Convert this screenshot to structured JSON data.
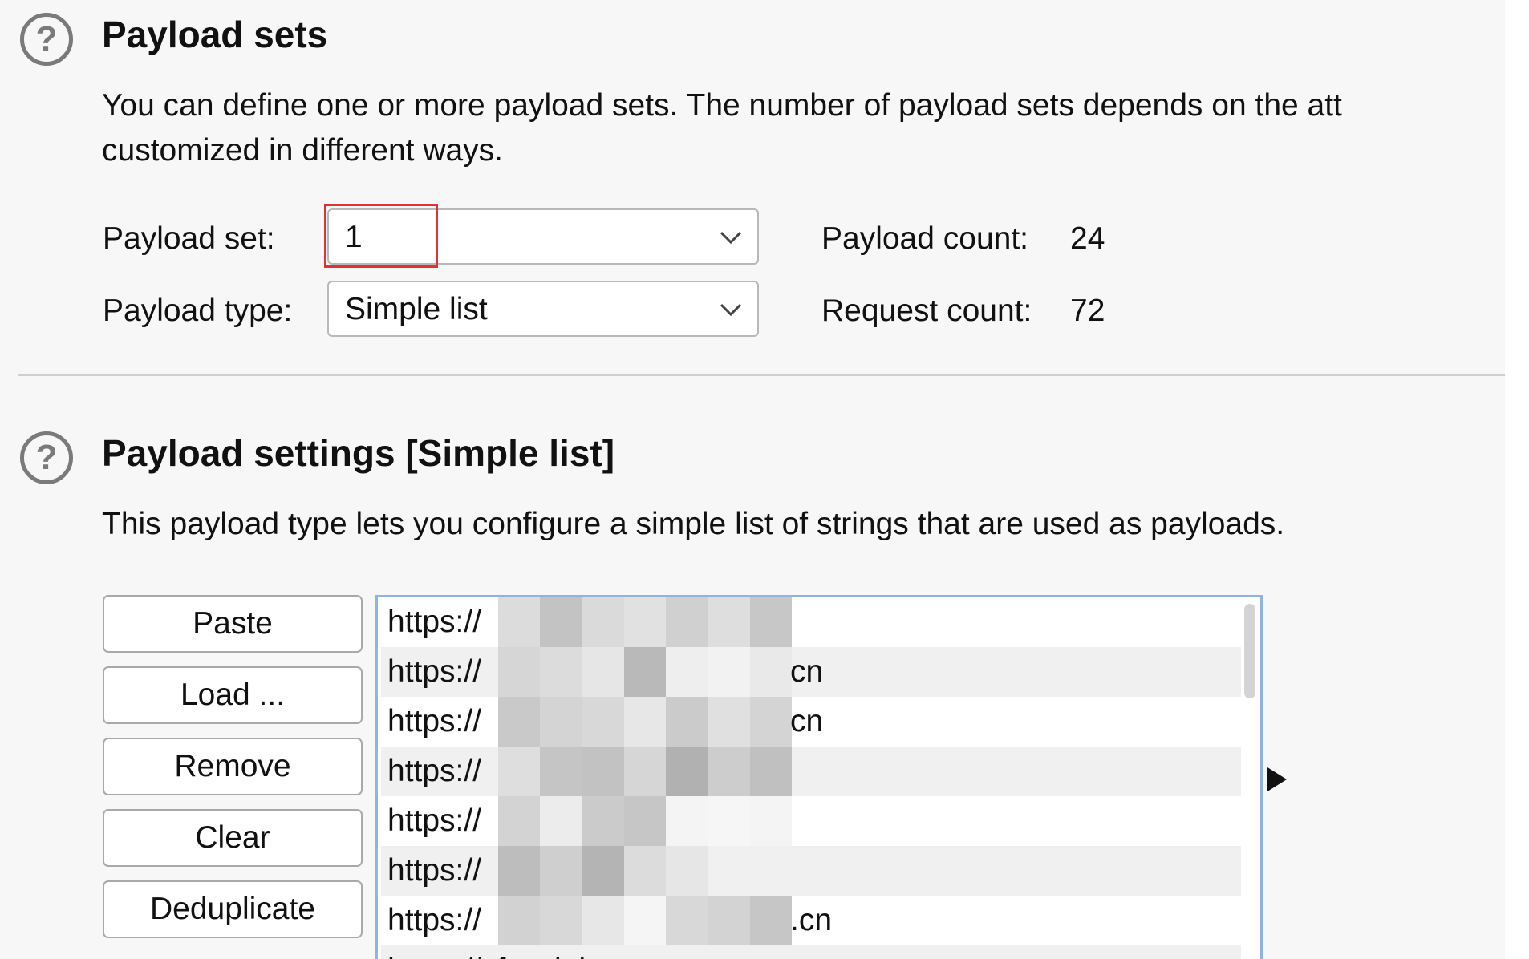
{
  "payload_sets": {
    "title": "Payload sets",
    "help_icon": "?",
    "description_line1": "You can define one or more payload sets. The number of payload sets depends on the att",
    "description_line2": "customized in different ways.",
    "payload_set_label": "Payload set:",
    "payload_set_value": "1",
    "payload_type_label": "Payload type:",
    "payload_type_value": "Simple list",
    "payload_count_label": "Payload count:",
    "payload_count_value": "24",
    "request_count_label": "Request count:",
    "request_count_value": "72"
  },
  "payload_settings": {
    "title": "Payload settings [Simple list]",
    "help_icon": "?",
    "description": "This payload type lets you configure a simple list of strings that are used as payloads.",
    "buttons": {
      "paste": "Paste",
      "load": "Load ...",
      "remove": "Remove",
      "clear": "Clear",
      "deduplicate": "Deduplicate"
    },
    "list_items": [
      {
        "prefix": "https://",
        "suffix": ""
      },
      {
        "prefix": "https://",
        "suffix": "cn"
      },
      {
        "prefix": "https://",
        "suffix": "cn"
      },
      {
        "prefix": "https://",
        "suffix": ""
      },
      {
        "prefix": "https://",
        "suffix": ""
      },
      {
        "prefix": "https://",
        "suffix": ""
      },
      {
        "prefix": "https://",
        "suffix": ".cn"
      },
      {
        "prefix": "https://zfzwdt.henan.gov.cn",
        "suffix": ""
      }
    ]
  },
  "colors": {
    "highlight_border": "#e03333",
    "list_border": "#8fb4e4",
    "panel_bg": "#f7f7f7"
  },
  "icons": {
    "help": "question-circle-icon",
    "dropdown": "chevron-down-icon",
    "expand": "triangle-right-icon"
  }
}
